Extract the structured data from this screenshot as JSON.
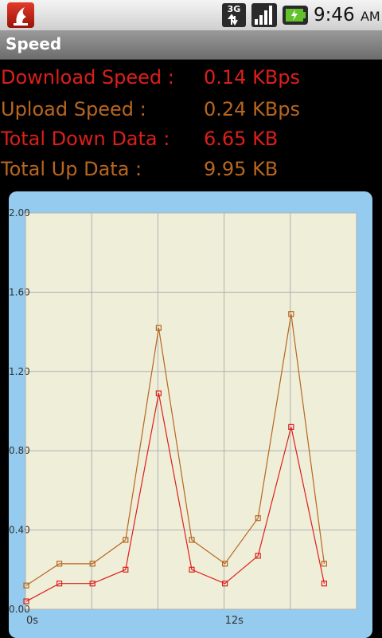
{
  "status_bar": {
    "network_label": "3G",
    "time": "9:46",
    "ampm": "AM",
    "icons": [
      "app-notification-icon",
      "3g-data-icon",
      "signal-strength-icon",
      "battery-charging-icon"
    ]
  },
  "title": "Speed",
  "stats": [
    {
      "label": "Download Speed :",
      "value": "0.14 KBps",
      "color": "#dd1f1a"
    },
    {
      "label": "Upload Speed :",
      "value": "0.24 KBps",
      "color": "#b8661e"
    },
    {
      "label": "Total Down Data :",
      "value": "6.65 KB",
      "color": "#dd1f1a"
    },
    {
      "label": "Total Up Data :",
      "value": "9.95 KB",
      "color": "#b8661e"
    }
  ],
  "chart_data": {
    "type": "line",
    "title": "",
    "xlabel": "",
    "ylabel": "",
    "ylim": [
      0,
      2.0
    ],
    "y_ticks": [
      "0.00",
      "0.40",
      "0.80",
      "1.20",
      "1.60",
      "2.00"
    ],
    "x_tick_labels": [
      "0s",
      "12s"
    ],
    "grid": true,
    "colors": {
      "background": "#efeed9",
      "grid": "#b0b0b0",
      "frame": "#94cbee"
    },
    "series": [
      {
        "values": [
          0.12,
          0.23,
          0.23,
          0.35,
          1.42,
          0.35,
          0.23,
          0.46,
          1.49,
          0.23
        ],
        "color": "#b8661e"
      },
      {
        "values": [
          0.04,
          0.13,
          0.13,
          0.2,
          1.09,
          0.2,
          0.13,
          0.27,
          0.92,
          0.13
        ],
        "color": "#dd1f1a"
      }
    ]
  }
}
